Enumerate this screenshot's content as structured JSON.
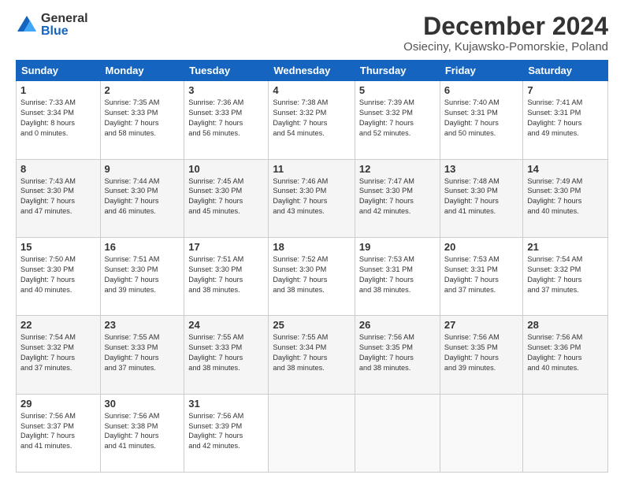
{
  "logo": {
    "general": "General",
    "blue": "Blue"
  },
  "title": "December 2024",
  "subtitle": "Osieciny, Kujawsko-Pomorskie, Poland",
  "days_header": [
    "Sunday",
    "Monday",
    "Tuesday",
    "Wednesday",
    "Thursday",
    "Friday",
    "Saturday"
  ],
  "weeks": [
    [
      {
        "day": "1",
        "info": "Sunrise: 7:33 AM\nSunset: 3:34 PM\nDaylight: 8 hours\nand 0 minutes."
      },
      {
        "day": "2",
        "info": "Sunrise: 7:35 AM\nSunset: 3:33 PM\nDaylight: 7 hours\nand 58 minutes."
      },
      {
        "day": "3",
        "info": "Sunrise: 7:36 AM\nSunset: 3:33 PM\nDaylight: 7 hours\nand 56 minutes."
      },
      {
        "day": "4",
        "info": "Sunrise: 7:38 AM\nSunset: 3:32 PM\nDaylight: 7 hours\nand 54 minutes."
      },
      {
        "day": "5",
        "info": "Sunrise: 7:39 AM\nSunset: 3:32 PM\nDaylight: 7 hours\nand 52 minutes."
      },
      {
        "day": "6",
        "info": "Sunrise: 7:40 AM\nSunset: 3:31 PM\nDaylight: 7 hours\nand 50 minutes."
      },
      {
        "day": "7",
        "info": "Sunrise: 7:41 AM\nSunset: 3:31 PM\nDaylight: 7 hours\nand 49 minutes."
      }
    ],
    [
      {
        "day": "8",
        "info": "Sunrise: 7:43 AM\nSunset: 3:30 PM\nDaylight: 7 hours\nand 47 minutes."
      },
      {
        "day": "9",
        "info": "Sunrise: 7:44 AM\nSunset: 3:30 PM\nDaylight: 7 hours\nand 46 minutes."
      },
      {
        "day": "10",
        "info": "Sunrise: 7:45 AM\nSunset: 3:30 PM\nDaylight: 7 hours\nand 45 minutes."
      },
      {
        "day": "11",
        "info": "Sunrise: 7:46 AM\nSunset: 3:30 PM\nDaylight: 7 hours\nand 43 minutes."
      },
      {
        "day": "12",
        "info": "Sunrise: 7:47 AM\nSunset: 3:30 PM\nDaylight: 7 hours\nand 42 minutes."
      },
      {
        "day": "13",
        "info": "Sunrise: 7:48 AM\nSunset: 3:30 PM\nDaylight: 7 hours\nand 41 minutes."
      },
      {
        "day": "14",
        "info": "Sunrise: 7:49 AM\nSunset: 3:30 PM\nDaylight: 7 hours\nand 40 minutes."
      }
    ],
    [
      {
        "day": "15",
        "info": "Sunrise: 7:50 AM\nSunset: 3:30 PM\nDaylight: 7 hours\nand 40 minutes."
      },
      {
        "day": "16",
        "info": "Sunrise: 7:51 AM\nSunset: 3:30 PM\nDaylight: 7 hours\nand 39 minutes."
      },
      {
        "day": "17",
        "info": "Sunrise: 7:51 AM\nSunset: 3:30 PM\nDaylight: 7 hours\nand 38 minutes."
      },
      {
        "day": "18",
        "info": "Sunrise: 7:52 AM\nSunset: 3:30 PM\nDaylight: 7 hours\nand 38 minutes."
      },
      {
        "day": "19",
        "info": "Sunrise: 7:53 AM\nSunset: 3:31 PM\nDaylight: 7 hours\nand 38 minutes."
      },
      {
        "day": "20",
        "info": "Sunrise: 7:53 AM\nSunset: 3:31 PM\nDaylight: 7 hours\nand 37 minutes."
      },
      {
        "day": "21",
        "info": "Sunrise: 7:54 AM\nSunset: 3:32 PM\nDaylight: 7 hours\nand 37 minutes."
      }
    ],
    [
      {
        "day": "22",
        "info": "Sunrise: 7:54 AM\nSunset: 3:32 PM\nDaylight: 7 hours\nand 37 minutes."
      },
      {
        "day": "23",
        "info": "Sunrise: 7:55 AM\nSunset: 3:33 PM\nDaylight: 7 hours\nand 37 minutes."
      },
      {
        "day": "24",
        "info": "Sunrise: 7:55 AM\nSunset: 3:33 PM\nDaylight: 7 hours\nand 38 minutes."
      },
      {
        "day": "25",
        "info": "Sunrise: 7:55 AM\nSunset: 3:34 PM\nDaylight: 7 hours\nand 38 minutes."
      },
      {
        "day": "26",
        "info": "Sunrise: 7:56 AM\nSunset: 3:35 PM\nDaylight: 7 hours\nand 38 minutes."
      },
      {
        "day": "27",
        "info": "Sunrise: 7:56 AM\nSunset: 3:35 PM\nDaylight: 7 hours\nand 39 minutes."
      },
      {
        "day": "28",
        "info": "Sunrise: 7:56 AM\nSunset: 3:36 PM\nDaylight: 7 hours\nand 40 minutes."
      }
    ],
    [
      {
        "day": "29",
        "info": "Sunrise: 7:56 AM\nSunset: 3:37 PM\nDaylight: 7 hours\nand 41 minutes."
      },
      {
        "day": "30",
        "info": "Sunrise: 7:56 AM\nSunset: 3:38 PM\nDaylight: 7 hours\nand 41 minutes."
      },
      {
        "day": "31",
        "info": "Sunrise: 7:56 AM\nSunset: 3:39 PM\nDaylight: 7 hours\nand 42 minutes."
      },
      null,
      null,
      null,
      null
    ]
  ]
}
